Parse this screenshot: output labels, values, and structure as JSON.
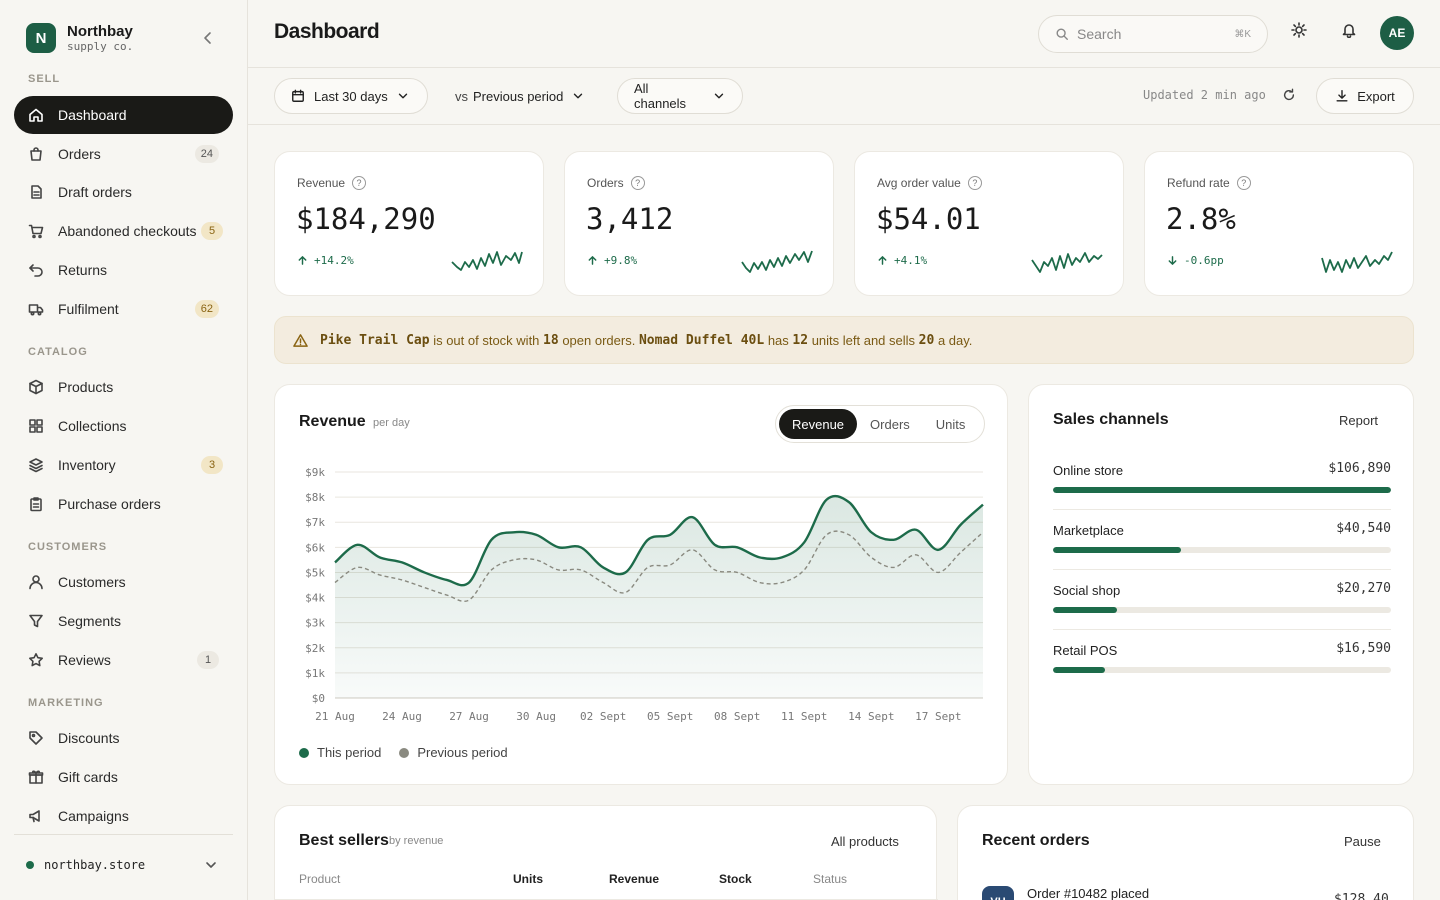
{
  "brand": {
    "initial": "N",
    "name": "Northbay",
    "subtitle": "supply co."
  },
  "sidebar": {
    "sections": [
      {
        "label": "SELL",
        "items": [
          {
            "label": "Dashboard",
            "icon": "home-icon",
            "active": true
          },
          {
            "label": "Orders",
            "icon": "bag-icon",
            "badge": "24"
          },
          {
            "label": "Draft orders",
            "icon": "draft-icon"
          },
          {
            "label": "Abandoned checkouts",
            "icon": "cart-icon",
            "badge": "5",
            "badge_style": "warn"
          },
          {
            "label": "Returns",
            "icon": "return-icon"
          },
          {
            "label": "Fulfilment",
            "icon": "truck-icon",
            "badge": "62",
            "badge_style": "warn"
          }
        ]
      },
      {
        "label": "CATALOG",
        "items": [
          {
            "label": "Products",
            "icon": "box-icon"
          },
          {
            "label": "Collections",
            "icon": "grid-icon"
          },
          {
            "label": "Inventory",
            "icon": "layers-icon",
            "badge": "3",
            "badge_style": "warn"
          },
          {
            "label": "Purchase orders",
            "icon": "clipboard-icon"
          }
        ]
      },
      {
        "label": "CUSTOMERS",
        "items": [
          {
            "label": "Customers",
            "icon": "user-icon"
          },
          {
            "label": "Segments",
            "icon": "filter-icon"
          },
          {
            "label": "Reviews",
            "icon": "star-icon",
            "badge": "1"
          }
        ]
      },
      {
        "label": "MARKETING",
        "items": [
          {
            "label": "Discounts",
            "icon": "tag-icon"
          },
          {
            "label": "Gift cards",
            "icon": "gift-icon"
          },
          {
            "label": "Campaigns",
            "icon": "megaphone-icon"
          }
        ]
      }
    ],
    "store": "northbay.store"
  },
  "header": {
    "title": "Dashboard",
    "search_placeholder": "Search",
    "search_shortcut": "⌘K",
    "avatar": "AE"
  },
  "toolbar": {
    "range": "Last 30 days",
    "compare_prefix": "vs",
    "compare": "Previous period",
    "channels": "All channels",
    "updated": "Updated 2 min ago",
    "export": "Export"
  },
  "kpis": [
    {
      "label": "Revenue",
      "value": "$184,290",
      "delta": "+14.2%",
      "direction": "up"
    },
    {
      "label": "Orders",
      "value": "3,412",
      "delta": "+9.8%",
      "direction": "up"
    },
    {
      "label": "Avg order value",
      "value": "$54.01",
      "delta": "+4.1%",
      "direction": "up"
    },
    {
      "label": "Refund rate",
      "value": "2.8%",
      "delta": "-0.6pp",
      "direction": "down"
    }
  ],
  "alert": {
    "product1": "Pike Trail Cap",
    "text1": "is out of stock with",
    "count1": "18",
    "text2": "open orders.",
    "product2": "Nomad Duffel 40L",
    "text3": "has",
    "count2": "12",
    "text4": "units left and sells",
    "count3": "20",
    "text5": "a day."
  },
  "revenue_card": {
    "title": "Revenue",
    "subtitle": "per day",
    "tabs": [
      "Revenue",
      "Orders",
      "Units"
    ],
    "active_tab": "Revenue",
    "legend": [
      "This period",
      "Previous period"
    ]
  },
  "chart_data": {
    "type": "area",
    "title": "Revenue",
    "ylim": [
      0,
      9000
    ],
    "y_ticks": [
      "$9k",
      "$8k",
      "$7k",
      "$6k",
      "$5k",
      "$4k",
      "$3k",
      "$2k",
      "$1k",
      "$0"
    ],
    "x_ticks": [
      "21 Aug",
      "24 Aug",
      "27 Aug",
      "30 Aug",
      "02 Sept",
      "05 Sept",
      "08 Sept",
      "11 Sept",
      "14 Sept",
      "17 Sept"
    ],
    "x": [
      "21 Aug",
      "22 Aug",
      "23 Aug",
      "24 Aug",
      "25 Aug",
      "26 Aug",
      "27 Aug",
      "28 Aug",
      "29 Aug",
      "30 Aug",
      "31 Aug",
      "01 Sept",
      "02 Sept",
      "03 Sept",
      "04 Sept",
      "05 Sept",
      "06 Sept",
      "07 Sept",
      "08 Sept",
      "09 Sept",
      "10 Sept",
      "11 Sept",
      "12 Sept",
      "13 Sept",
      "14 Sept",
      "15 Sept",
      "16 Sept",
      "17 Sept",
      "18 Sept",
      "19 Sept"
    ],
    "series": [
      {
        "name": "This period",
        "color": "#1d6b4a",
        "values": [
          5400,
          6100,
          5600,
          5400,
          5000,
          4700,
          4600,
          6300,
          6600,
          6500,
          6000,
          6000,
          5200,
          5000,
          6300,
          6500,
          7200,
          6100,
          6000,
          5600,
          5600,
          6200,
          7900,
          7800,
          6600,
          6300,
          6700,
          5900,
          6900,
          7700
        ]
      },
      {
        "name": "Previous period",
        "color": "#8a8a80",
        "values": [
          4600,
          5200,
          4900,
          4700,
          4400,
          4100,
          3900,
          5100,
          5500,
          5500,
          5100,
          5100,
          4600,
          4200,
          5200,
          5300,
          5900,
          5100,
          5000,
          4600,
          4600,
          5100,
          6500,
          6500,
          5600,
          5200,
          5700,
          5000,
          5800,
          6600
        ],
        "dashed": true
      }
    ]
  },
  "channels": {
    "title": "Sales channels",
    "link": "Report",
    "items": [
      {
        "name": "Online store",
        "value": "$106,890",
        "share": 1.0
      },
      {
        "name": "Marketplace",
        "value": "$40,540",
        "share": 0.38
      },
      {
        "name": "Social shop",
        "value": "$20,270",
        "share": 0.19
      },
      {
        "name": "Retail POS",
        "value": "$16,590",
        "share": 0.155
      }
    ]
  },
  "best_sellers": {
    "title": "Best sellers",
    "subtitle": "by revenue",
    "link": "All products",
    "columns": [
      "Product",
      "Units",
      "Revenue",
      "Stock",
      "Status"
    ]
  },
  "recent_orders": {
    "title": "Recent orders",
    "link": "Pause",
    "first": {
      "initials": "VH",
      "text": "Order #10482 placed",
      "amount": "$128.40"
    }
  },
  "colors": {
    "accent": "#1d5e45",
    "dark": "#1a1a17",
    "warn_bg": "#f3ecdf"
  }
}
